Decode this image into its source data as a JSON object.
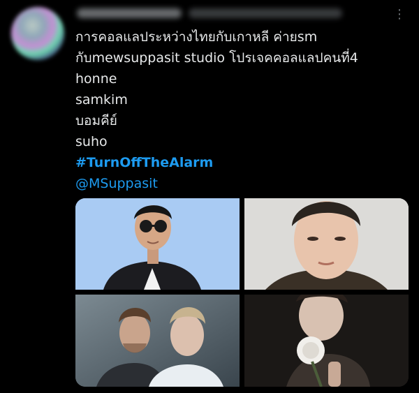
{
  "tweet": {
    "lines": [
      "การคอลแลประหว่างไทยกับเกาหลี ค่ายsm",
      "กับmewsuppasit studio โปรเจคคอลแลปคนที่4",
      "honne",
      "samkim",
      "บอมคีย์",
      "suho"
    ],
    "hashtag": "#TurnOffTheAlarm",
    "mention": "@MSuppasit",
    "more_glyph": "⋮"
  },
  "colors": {
    "background": "#000000",
    "text": "#e7e9ea",
    "link": "#1d9bf0",
    "muted": "#71767b"
  },
  "media": {
    "icons": [
      "photo",
      "photo",
      "photo",
      "photo"
    ]
  }
}
